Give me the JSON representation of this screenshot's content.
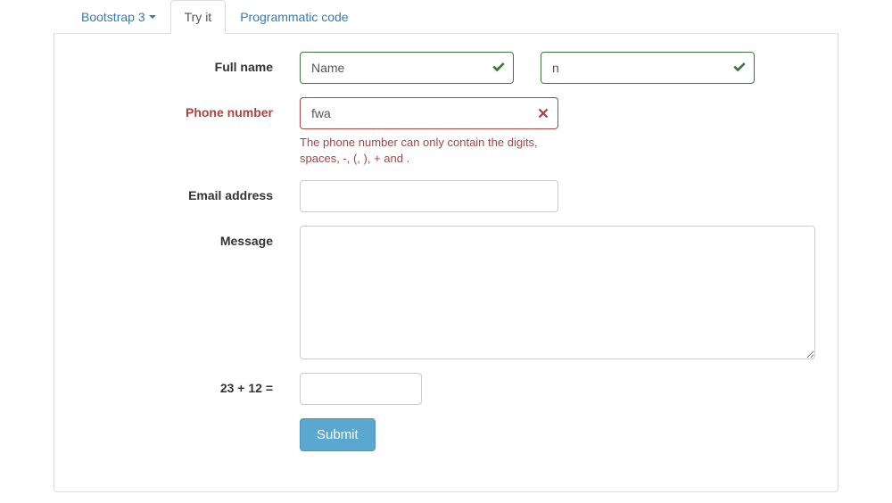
{
  "tabs": {
    "dropdown_label": "Bootstrap 3",
    "tryit_label": "Try it",
    "programmatic_label": "Programmatic code"
  },
  "form": {
    "fullname_label": "Full name",
    "fullname_first_value": "Name",
    "fullname_last_value": "n",
    "phone_label": "Phone number",
    "phone_value": "fwa",
    "phone_error": "The phone number can only contain the digits, spaces, -, (, ), + and .",
    "email_label": "Email address",
    "email_value": "",
    "message_label": "Message",
    "message_value": "",
    "captcha_label": "23 + 12 =",
    "captcha_value": "",
    "submit_label": "Submit"
  }
}
